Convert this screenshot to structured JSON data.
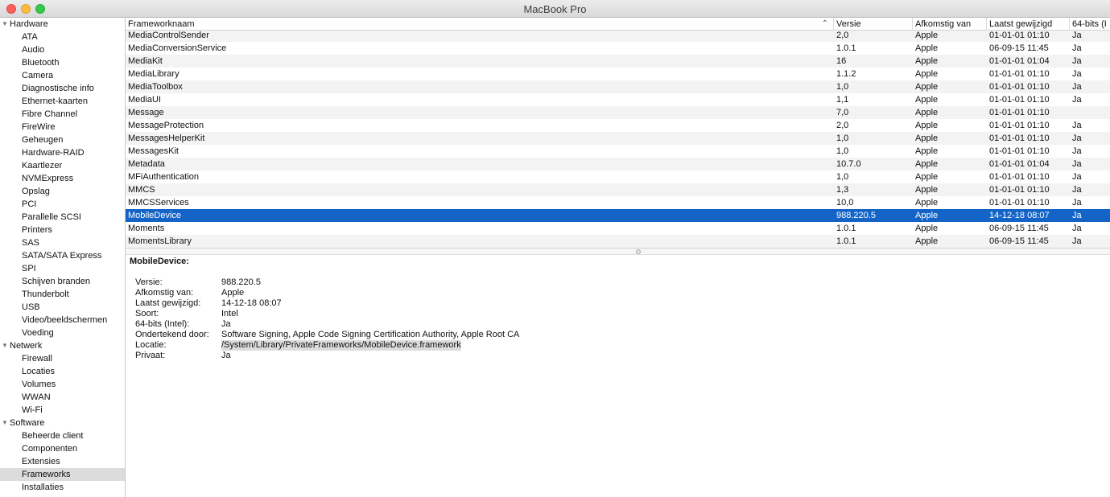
{
  "window": {
    "title": "MacBook Pro"
  },
  "sidebar": {
    "groups": [
      {
        "label": "Hardware",
        "items": [
          "ATA",
          "Audio",
          "Bluetooth",
          "Camera",
          "Diagnostische info",
          "Ethernet-kaarten",
          "Fibre Channel",
          "FireWire",
          "Geheugen",
          "Hardware-RAID",
          "Kaartlezer",
          "NVMExpress",
          "Opslag",
          "PCI",
          "Parallelle SCSI",
          "Printers",
          "SAS",
          "SATA/SATA Express",
          "SPI",
          "Schijven branden",
          "Thunderbolt",
          "USB",
          "Video/beeldschermen",
          "Voeding"
        ]
      },
      {
        "label": "Netwerk",
        "items": [
          "Firewall",
          "Locaties",
          "Volumes",
          "WWAN",
          "Wi-Fi"
        ]
      },
      {
        "label": "Software",
        "items": [
          "Beheerde client",
          "Componenten",
          "Extensies",
          "Frameworks",
          "Installaties"
        ]
      }
    ],
    "selected": "Frameworks"
  },
  "table": {
    "columns": [
      "Frameworknaam",
      "Versie",
      "Afkomstig van",
      "Laatst gewijzigd",
      "64-bits (I"
    ],
    "sort_icon": "chevron-up-icon",
    "rows": [
      [
        "MediaControlSender",
        "2,0",
        "Apple",
        "01-01-01 01:10",
        "Ja"
      ],
      [
        "MediaConversionService",
        "1.0.1",
        "Apple",
        "06-09-15 11:45",
        "Ja"
      ],
      [
        "MediaKit",
        "16",
        "Apple",
        "01-01-01 01:04",
        "Ja"
      ],
      [
        "MediaLibrary",
        "1.1.2",
        "Apple",
        "01-01-01 01:10",
        "Ja"
      ],
      [
        "MediaToolbox",
        "1,0",
        "Apple",
        "01-01-01 01:10",
        "Ja"
      ],
      [
        "MediaUI",
        "1,1",
        "Apple",
        "01-01-01 01:10",
        "Ja"
      ],
      [
        "Message",
        "7,0",
        "Apple",
        "01-01-01 01:10",
        ""
      ],
      [
        "MessageProtection",
        "2,0",
        "Apple",
        "01-01-01 01:10",
        "Ja"
      ],
      [
        "MessagesHelperKit",
        "1,0",
        "Apple",
        "01-01-01 01:10",
        "Ja"
      ],
      [
        "MessagesKit",
        "1,0",
        "Apple",
        "01-01-01 01:10",
        "Ja"
      ],
      [
        "Metadata",
        "10.7.0",
        "Apple",
        "01-01-01 01:04",
        "Ja"
      ],
      [
        "MFiAuthentication",
        "1,0",
        "Apple",
        "01-01-01 01:10",
        "Ja"
      ],
      [
        "MMCS",
        "1,3",
        "Apple",
        "01-01-01 01:10",
        "Ja"
      ],
      [
        "MMCSServices",
        "10,0",
        "Apple",
        "01-01-01 01:10",
        "Ja"
      ],
      [
        "MobileDevice",
        "988.220.5",
        "Apple",
        "14-12-18 08:07",
        "Ja"
      ],
      [
        "Moments",
        "1.0.1",
        "Apple",
        "06-09-15 11:45",
        "Ja"
      ],
      [
        "MomentsLibrary",
        "1.0.1",
        "Apple",
        "06-09-15 11:45",
        "Ja"
      ]
    ],
    "selected_index": 14
  },
  "detail": {
    "title": "MobileDevice:",
    "properties": [
      {
        "key": "Versie:",
        "value": "988.220.5"
      },
      {
        "key": "Afkomstig van:",
        "value": "Apple"
      },
      {
        "key": "Laatst gewijzigd:",
        "value": "14-12-18 08:07"
      },
      {
        "key": "Soort:",
        "value": "Intel"
      },
      {
        "key": "64-bits (Intel):",
        "value": "Ja"
      },
      {
        "key": "Ondertekend door:",
        "value": "Software Signing, Apple Code Signing Certification Authority, Apple Root CA"
      },
      {
        "key": "Locatie:",
        "value": "/System/Library/PrivateFrameworks/MobileDevice.framework"
      },
      {
        "key": "Privaat:",
        "value": "Ja"
      }
    ],
    "highlighted_key": "Locatie:"
  },
  "colors": {
    "selection": "#1464c8",
    "sidebar_selection": "#dcdcdc",
    "zebra": "#f3f3f3"
  }
}
